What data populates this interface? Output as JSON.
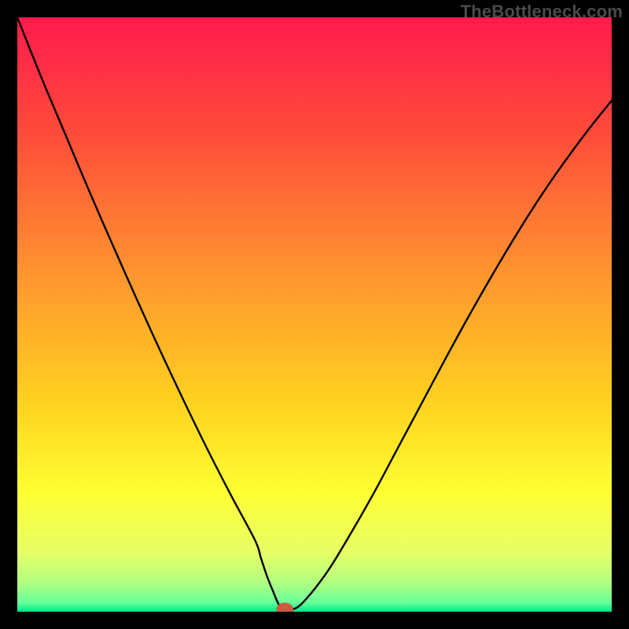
{
  "watermark": "TheBottleneck.com",
  "chart_data": {
    "type": "line",
    "title": "",
    "xlabel": "",
    "ylabel": "",
    "xlim": [
      0,
      100
    ],
    "ylim": [
      0,
      100
    ],
    "grid": false,
    "background_gradient": [
      {
        "pos": 0.0,
        "color": "#ff1a4d"
      },
      {
        "pos": 0.2,
        "color": "#ff4d3a"
      },
      {
        "pos": 0.45,
        "color": "#ff9a2e"
      },
      {
        "pos": 0.65,
        "color": "#ffd21f"
      },
      {
        "pos": 0.8,
        "color": "#ffff33"
      },
      {
        "pos": 0.9,
        "color": "#e6ff66"
      },
      {
        "pos": 0.95,
        "color": "#b3ff80"
      },
      {
        "pos": 0.985,
        "color": "#66ff99"
      },
      {
        "pos": 1.0,
        "color": "#00e68a"
      }
    ],
    "series": [
      {
        "name": "bottleneck-curve",
        "color": "#000000",
        "x": [
          0,
          4,
          8,
          12,
          16,
          20,
          24,
          28,
          32,
          36,
          40,
          41,
          42,
          43,
          44,
          45,
          46,
          48,
          52,
          56,
          60,
          64,
          68,
          72,
          76,
          80,
          84,
          88,
          92,
          96,
          100
        ],
        "y": [
          100,
          90,
          80.5,
          71,
          61.8,
          52.8,
          44,
          35.5,
          27.3,
          19.5,
          12,
          9,
          6,
          3.5,
          1.2,
          0.3,
          0.3,
          1.5,
          6.5,
          13,
          20,
          27.5,
          35,
          42.5,
          49.8,
          56.8,
          63.5,
          69.8,
          75.6,
          81,
          86
        ]
      }
    ],
    "markers": [
      {
        "name": "min-marker",
        "x": 45,
        "y": 0.4,
        "color": "#cc5a40",
        "rx": 5,
        "ry": 4
      }
    ]
  }
}
